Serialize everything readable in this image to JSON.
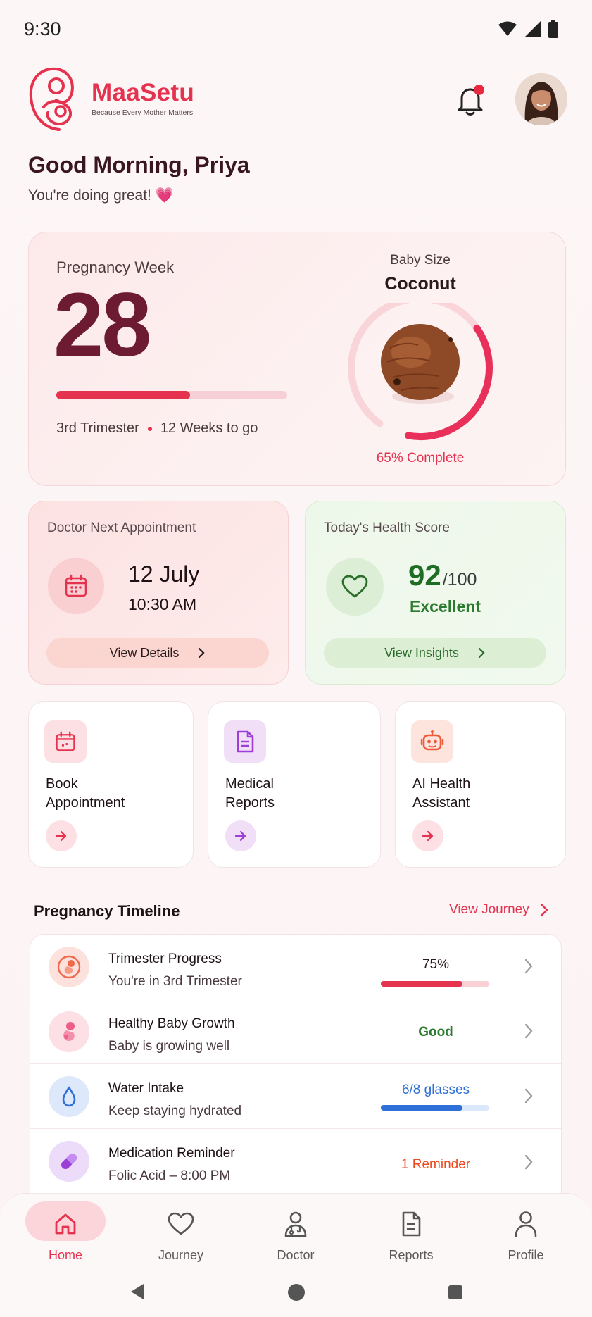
{
  "status_bar": {
    "time": "9:30"
  },
  "header": {
    "app_name": "MaaSetu",
    "tagline": "Because Every Mother Matters",
    "notification_icon": "bell-icon",
    "has_unread": true
  },
  "greeting": {
    "title": "Good Morning, Priya",
    "subtitle": "You're doing great! 💗"
  },
  "pregnancy": {
    "week_label": "Pregnancy Week",
    "week": "28",
    "week_progress": 0.58,
    "trimester": "3rd Trimester",
    "weeks_to_go": "12 Weeks to go",
    "baby_size_label": "Baby Size",
    "baby_size": "Coconut",
    "complete_text": "65% Complete",
    "complete_fraction": 0.65
  },
  "appointment": {
    "title": "Doctor Next Appointment",
    "date": "12 July",
    "time": "10:30 AM",
    "button": "View Details"
  },
  "health_score": {
    "title": "Today's Health Score",
    "score": "92",
    "max": "/100",
    "status": "Excellent",
    "button": "View Insights"
  },
  "quick_actions": [
    {
      "label_line1": "Book",
      "label_line2": "Appointment",
      "icon": "calendar-icon",
      "color": "#e5334f"
    },
    {
      "label_line1": "Medical",
      "label_line2": "Reports",
      "icon": "document-icon",
      "color": "#9b3fd6"
    },
    {
      "label_line1": "AI Health",
      "label_line2": "Assistant",
      "icon": "robot-icon",
      "color": "#ef5a3c"
    }
  ],
  "timeline": {
    "title": "Pregnancy Timeline",
    "link": "View Journey",
    "items": [
      {
        "name": "Trimester Progress",
        "sub": "You're in 3rd Trimester",
        "value": "75%",
        "progress": 0.75,
        "icon": "fetus-icon"
      },
      {
        "name": "Healthy Baby Growth",
        "sub": "Baby is growing well",
        "value": "Good",
        "icon": "baby-icon"
      },
      {
        "name": "Water Intake",
        "sub": "Keep staying hydrated",
        "value": "6/8 glasses",
        "progress": 0.75,
        "icon": "water-drop-icon"
      },
      {
        "name": "Medication Reminder",
        "sub": "Folic Acid – 8:00 PM",
        "value": "1 Reminder",
        "icon": "pill-icon"
      }
    ]
  },
  "bottom_nav": [
    {
      "label": "Home",
      "icon": "home-icon",
      "active": true
    },
    {
      "label": "Journey",
      "icon": "heart-icon",
      "active": false
    },
    {
      "label": "Doctor",
      "icon": "doctor-icon",
      "active": false
    },
    {
      "label": "Reports",
      "icon": "reports-icon",
      "active": false
    },
    {
      "label": "Profile",
      "icon": "profile-icon",
      "active": false
    }
  ],
  "colors": {
    "brand": "#e5334f",
    "week_number": "#6d1a33",
    "health_green": "#2b7a30",
    "water_blue": "#2f6fd8",
    "reminder_orange": "#ef4a1f"
  }
}
